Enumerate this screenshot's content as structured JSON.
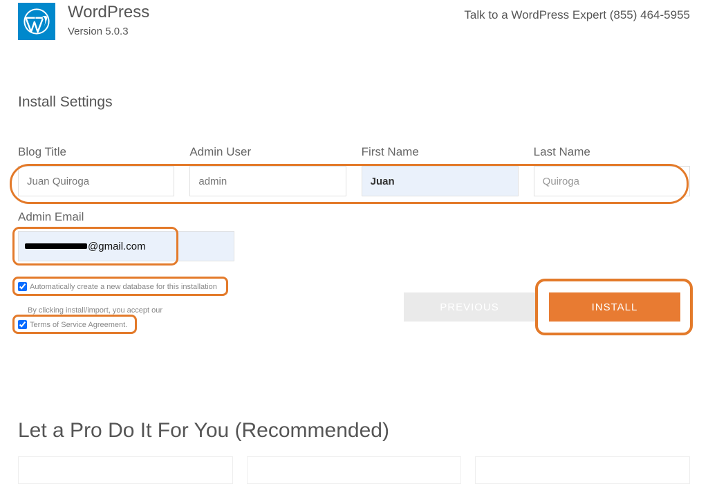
{
  "header": {
    "brand": "WordPress",
    "version": "Version 5.0.3",
    "contact": "Talk to a WordPress Expert (855) 464-5955"
  },
  "section_title": "Install Settings",
  "fields": {
    "blog_title": {
      "label": "Blog Title",
      "value": "Juan Quiroga"
    },
    "admin_user": {
      "label": "Admin User",
      "value": "admin"
    },
    "first_name": {
      "label": "First Name",
      "value": "Juan"
    },
    "last_name": {
      "label": "Last Name",
      "value": "Quiroga"
    },
    "admin_email": {
      "label": "Admin Email",
      "value": "@gmail.com"
    }
  },
  "checks": {
    "auto_db": {
      "label": "Automatically create a new database for this installation",
      "checked": true
    },
    "accept_pretext": "By clicking install/import, you accept our",
    "tos": {
      "label": "Terms of Service Agreement.",
      "checked": true
    }
  },
  "buttons": {
    "previous": "PREVIOUS",
    "install": "INSTALL"
  },
  "pro_heading": "Let a Pro Do It For You (Recommended)"
}
